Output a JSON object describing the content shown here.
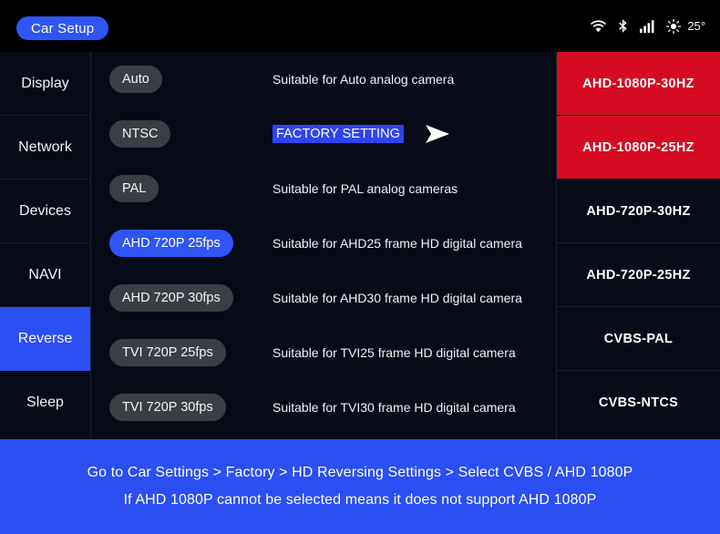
{
  "topbar": {
    "title": "Car Setup",
    "status": {
      "wifi_icon": "wifi-icon",
      "bluetooth_icon": "bluetooth-icon",
      "signal_icon": "signal-bars-icon",
      "brightness_icon": "brightness-icon",
      "temperature": "25°"
    }
  },
  "sidebar": {
    "items": [
      {
        "label": "Display",
        "active": false
      },
      {
        "label": "Network",
        "active": false
      },
      {
        "label": "Devices",
        "active": false
      },
      {
        "label": "NAVI",
        "active": false
      },
      {
        "label": "Reverse",
        "active": true
      },
      {
        "label": "Sleep",
        "active": false
      }
    ]
  },
  "middle": {
    "rows": [
      {
        "option": "Auto",
        "selected": false,
        "desc": "Suitable for Auto analog camera",
        "is_factory": false
      },
      {
        "option": "NTSC",
        "selected": false,
        "desc": "FACTORY SETTING",
        "is_factory": true
      },
      {
        "option": "PAL",
        "selected": false,
        "desc": "Suitable for PAL analog cameras",
        "is_factory": false
      },
      {
        "option": "AHD 720P 25fps",
        "selected": true,
        "desc": "Suitable for AHD25 frame HD digital camera",
        "is_factory": false
      },
      {
        "option": "AHD 720P 30fps",
        "selected": false,
        "desc": "Suitable for AHD30 frame HD digital camera",
        "is_factory": false
      },
      {
        "option": "TVI 720P 25fps",
        "selected": false,
        "desc": "Suitable for TVI25 frame HD digital camera",
        "is_factory": false
      },
      {
        "option": "TVI 720P 30fps",
        "selected": false,
        "desc": "Suitable for TVI30 frame HD digital camera",
        "is_factory": false
      }
    ],
    "factory_arrow_icon": "arrow-right-icon"
  },
  "right": {
    "rows": [
      {
        "label": "AHD-1080P-30HZ",
        "highlight": true
      },
      {
        "label": "AHD-1080P-25HZ",
        "highlight": true
      },
      {
        "label": "AHD-720P-30HZ",
        "highlight": false
      },
      {
        "label": "AHD-720P-25HZ",
        "highlight": false
      },
      {
        "label": "CVBS-PAL",
        "highlight": false
      },
      {
        "label": "CVBS-NTCS",
        "highlight": false
      }
    ]
  },
  "banner": {
    "line1": "Go to Car Settings > Factory > HD Reversing Settings > Select CVBS / AHD 1080P",
    "line2": "If AHD 1080P cannot be selected means it does not support AHD 1080P"
  },
  "colors": {
    "accent_blue": "#2a4ff2",
    "pill_blue": "#2f55f5",
    "highlight_red": "#d60a20",
    "panel_bg": "#070b18",
    "pill_grey": "#3a3e45",
    "topbar_bg": "#000000"
  }
}
